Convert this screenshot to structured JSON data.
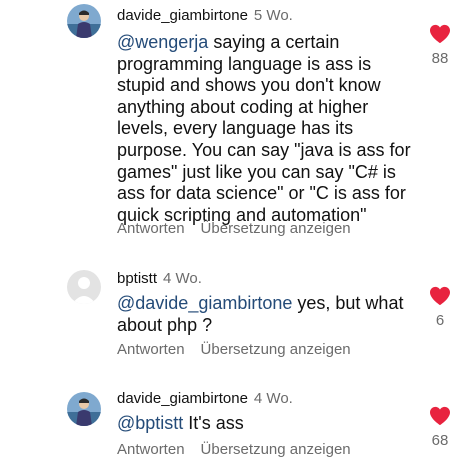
{
  "comments": [
    {
      "username": "davide_giambirtone",
      "time": "5 Wo.",
      "mention": "@wengerja",
      "text": " saying a certain programming language is ass is stupid and shows you don't know anything about coding at higher levels, every language has its purpose. You can say \"java is ass for games\" just like you can say \"C# is ass for data science\" or \"C is ass for quick scripting and automation\"",
      "reply_label": "Antworten",
      "translate_label": "Übersetzung anzeigen",
      "likes": "88",
      "avatar": "photo-avatar"
    },
    {
      "username": "bptistt",
      "time": "4 Wo.",
      "mention": "@davide_giambirtone",
      "text": " yes, but what about php ?",
      "reply_label": "Antworten",
      "translate_label": "Übersetzung anzeigen",
      "likes": "6",
      "avatar": "default-avatar"
    },
    {
      "username": "davide_giambirtone",
      "time": "4 Wo.",
      "mention": "@bptistt",
      "text": " It's ass",
      "reply_label": "Antworten",
      "translate_label": "Übersetzung anzeigen",
      "likes": "68",
      "avatar": "photo-avatar"
    }
  ],
  "colors": {
    "heart": "#e8233f",
    "mention": "#244b78",
    "secondary_text": "#6b6b6b"
  }
}
